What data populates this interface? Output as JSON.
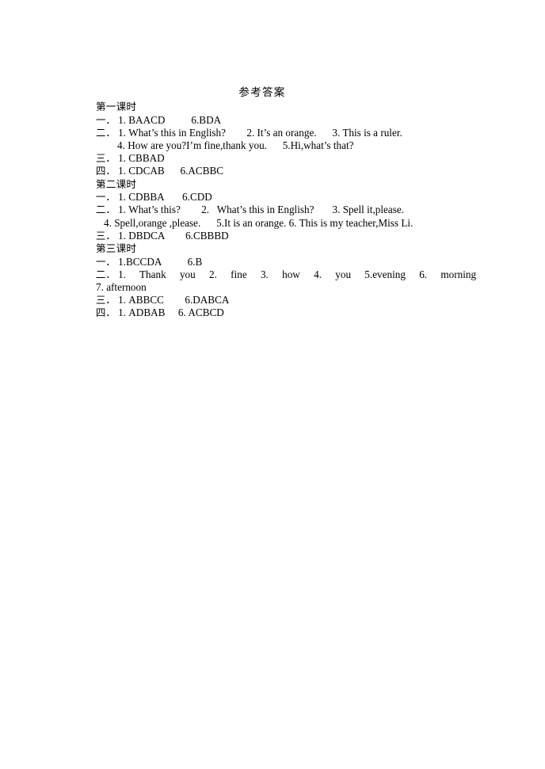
{
  "document": {
    "title": "参考答案",
    "sections": [
      {
        "heading": "第一课时",
        "lines": [
          {
            "marker": "一．",
            "text": "1. BAACD          6.BDA",
            "indent": "none"
          },
          {
            "marker": "二．",
            "text": "1. What’s this in English?        2. It’s an orange.      3. This is a ruler.",
            "indent": "none"
          },
          {
            "marker": "",
            "text": "4. How are you?I’m fine,thank you.      5.Hi,what’s that?",
            "indent": "a"
          },
          {
            "marker": "三．",
            "text": "1. CBBAD",
            "indent": "none"
          },
          {
            "marker": "四．",
            "text": "1. CDCAB      6.ACBBC",
            "indent": "none"
          }
        ]
      },
      {
        "heading": "第二课时",
        "lines": [
          {
            "marker": "一．",
            "text": "1. CDBBA       6.CDD",
            "indent": "none"
          },
          {
            "marker": "二．",
            "text": "1. What’s this?        2.   What’s this in English?       3. Spell it,please.",
            "indent": "none"
          },
          {
            "marker": "",
            "text": "4. Spell,orange ,please.      5.It is an orange. 6. This is my teacher,Miss Li.",
            "indent": "b"
          },
          {
            "marker": "三．",
            "text": "1. DBDCA        6.CBBBD",
            "indent": "none"
          }
        ]
      },
      {
        "heading": "第三课时",
        "lines": [
          {
            "marker": "一．",
            "text": "1.BCCDA          6.B",
            "indent": "none"
          },
          {
            "marker": "二．",
            "text": "1. Thank you     2. fine    3. how      4. you    5.evening 6. morning",
            "indent": "justify"
          },
          {
            "marker": "",
            "text": "7. afternoon",
            "indent": "none"
          },
          {
            "marker": "三．",
            "text": "1. ABBCC        6.DABCA",
            "indent": "none"
          },
          {
            "marker": "四．",
            "text": "1. ADBAB     6. ACBCD",
            "indent": "none"
          }
        ]
      }
    ]
  }
}
